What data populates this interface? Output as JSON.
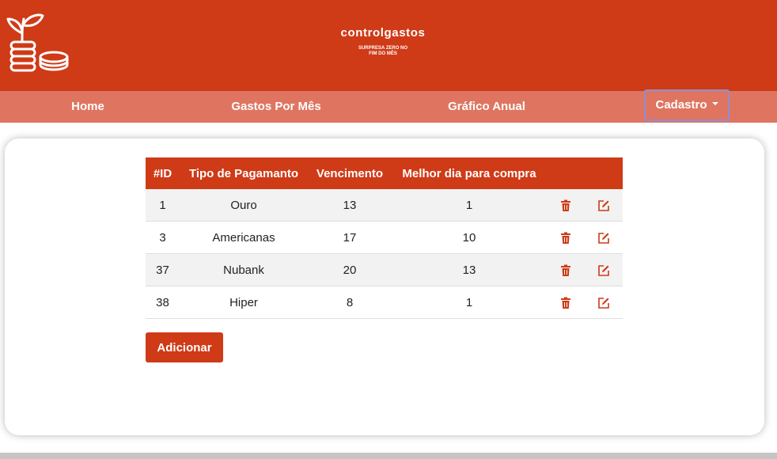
{
  "brand": {
    "name": "controlgastos",
    "tagline_line1": "SURPRESA ZERO NO",
    "tagline_line2": "FIM DO MÊS"
  },
  "nav": {
    "home": "Home",
    "gastos_por_mes": "Gastos Por Mês",
    "grafico_anual": "Gráfico Anual",
    "cadastro": "Cadastro"
  },
  "table": {
    "headers": [
      "#ID",
      "Tipo de Pagamanto",
      "Vencimento",
      "Melhor dia para compra",
      "",
      ""
    ],
    "rows": [
      {
        "id": "1",
        "tipo": "Ouro",
        "vencimento": "13",
        "melhor_dia": "1"
      },
      {
        "id": "3",
        "tipo": "Americanas",
        "vencimento": "17",
        "melhor_dia": "10"
      },
      {
        "id": "37",
        "tipo": "Nubank",
        "vencimento": "20",
        "melhor_dia": "13"
      },
      {
        "id": "38",
        "tipo": "Hiper",
        "vencimento": "8",
        "melhor_dia": "1"
      }
    ]
  },
  "actions": {
    "delete_icon": "trash-icon",
    "edit_icon": "edit-icon",
    "add_label": "Adicionar"
  },
  "colors": {
    "primary": "#cf3a17",
    "nav_background": "#df7560",
    "row_stripe": "#f2f2f2",
    "dropdown_focus_border": "#8e8ed6"
  }
}
